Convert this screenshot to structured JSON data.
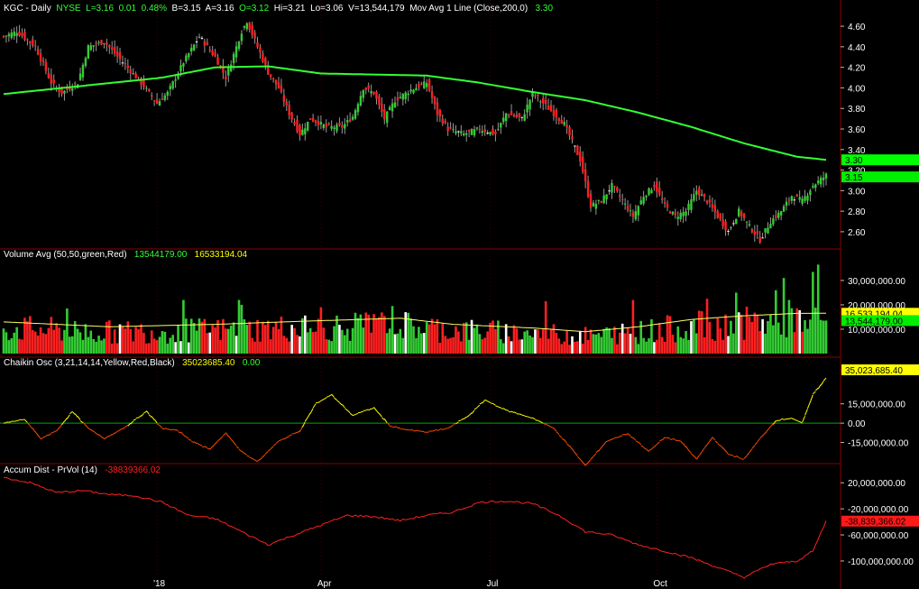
{
  "colors": {
    "background": "#000000",
    "up": "#33cc33",
    "down": "#ff2020",
    "flat": "#ffffff",
    "ma": "#33ff33",
    "chaikin": "#ffff00",
    "accum": "#ff2020",
    "axis_sep": "#8b0000"
  },
  "header": {
    "symbol": "KGC - Daily",
    "exchange": "NYSE",
    "last": "L=3.16",
    "change": "0.01",
    "change_pct": "0.48%",
    "bid": "B=3.15",
    "ask": "A=3.16",
    "open": "O=3.12",
    "high": "Hi=3.21",
    "low": "Lo=3.06",
    "volume": "V=13,544,179",
    "ma_label": "Mov Avg 1 Line (Close,200,0)",
    "ma_value": "3.30"
  },
  "volume_header": {
    "label": "Volume Avg (50,50,green,Red)",
    "v1": "13544179.00",
    "v2": "16533194.04"
  },
  "chaikin_header": {
    "label": "Chaikin Osc (3,21,14,14,Yellow,Red,Black)",
    "v1": "35023685.40",
    "v2": "0.00"
  },
  "accum_header": {
    "label": "Accum Dist - PrVol (14)",
    "v1": "-38839366.02"
  },
  "x_labels": [
    "'18",
    "Apr",
    "Jul",
    "Oct"
  ],
  "price_ticks": [
    "4.60",
    "4.40",
    "4.20",
    "4.00",
    "3.80",
    "3.60",
    "3.40",
    "3.20",
    "3.00",
    "2.80",
    "2.60"
  ],
  "price_tags": [
    "3.30",
    "3.15"
  ],
  "volume_ticks": [
    "30,000,000.00",
    "20,000,000.00",
    "10,000,000.00"
  ],
  "volume_tags": [
    "16,533,194.04",
    "13,544,179.00"
  ],
  "chaikin_ticks": [
    "15,000,000.00",
    "0.00",
    "-15,000,000.00"
  ],
  "chaikin_tag": "35,023,685.40",
  "accum_ticks": [
    "20,000,000.00",
    "-20,000,000.00",
    "-60,000,000.00",
    "-100,000,000.00"
  ],
  "accum_tag": "-38,839,366.02",
  "chart_data": [
    {
      "type": "candlestick",
      "title": "KGC - Daily",
      "ylim": [
        2.45,
        4.75
      ],
      "close_path": [
        [
          0,
          4.5
        ],
        [
          5,
          4.55
        ],
        [
          12,
          4.4
        ],
        [
          18,
          4.05
        ],
        [
          22,
          3.95
        ],
        [
          28,
          4.05
        ],
        [
          32,
          4.4
        ],
        [
          38,
          4.45
        ],
        [
          45,
          4.25
        ],
        [
          52,
          4.05
        ],
        [
          58,
          3.85
        ],
        [
          62,
          3.95
        ],
        [
          68,
          4.25
        ],
        [
          74,
          4.5
        ],
        [
          80,
          4.3
        ],
        [
          84,
          4.1
        ],
        [
          90,
          4.55
        ],
        [
          92,
          4.65
        ],
        [
          96,
          4.4
        ],
        [
          100,
          4.15
        ],
        [
          104,
          4.0
        ],
        [
          108,
          3.75
        ],
        [
          112,
          3.55
        ],
        [
          116,
          3.7
        ],
        [
          122,
          3.62
        ],
        [
          128,
          3.62
        ],
        [
          132,
          3.72
        ],
        [
          136,
          4.0
        ],
        [
          140,
          3.95
        ],
        [
          144,
          3.7
        ],
        [
          148,
          3.88
        ],
        [
          154,
          3.98
        ],
        [
          160,
          4.05
        ],
        [
          164,
          3.75
        ],
        [
          168,
          3.6
        ],
        [
          174,
          3.55
        ],
        [
          180,
          3.6
        ],
        [
          186,
          3.55
        ],
        [
          190,
          3.75
        ],
        [
          196,
          3.7
        ],
        [
          200,
          3.95
        ],
        [
          206,
          3.8
        ],
        [
          212,
          3.65
        ],
        [
          218,
          3.3
        ],
        [
          222,
          2.85
        ],
        [
          226,
          2.9
        ],
        [
          230,
          3.05
        ],
        [
          234,
          2.9
        ],
        [
          238,
          2.75
        ],
        [
          242,
          2.95
        ],
        [
          246,
          3.05
        ],
        [
          250,
          2.85
        ],
        [
          254,
          2.75
        ],
        [
          258,
          2.8
        ],
        [
          262,
          3.0
        ],
        [
          266,
          2.9
        ],
        [
          270,
          2.75
        ],
        [
          274,
          2.6
        ],
        [
          278,
          2.8
        ],
        [
          282,
          2.65
        ],
        [
          286,
          2.52
        ],
        [
          290,
          2.7
        ],
        [
          294,
          2.8
        ],
        [
          298,
          2.95
        ],
        [
          302,
          2.9
        ],
        [
          306,
          3.05
        ],
        [
          311,
          3.15
        ]
      ],
      "ma_path": [
        [
          0,
          3.94
        ],
        [
          30,
          4.02
        ],
        [
          60,
          4.1
        ],
        [
          80,
          4.2
        ],
        [
          100,
          4.21
        ],
        [
          120,
          4.14
        ],
        [
          140,
          4.13
        ],
        [
          160,
          4.12
        ],
        [
          180,
          4.05
        ],
        [
          200,
          3.96
        ],
        [
          220,
          3.88
        ],
        [
          240,
          3.76
        ],
        [
          260,
          3.62
        ],
        [
          280,
          3.46
        ],
        [
          300,
          3.33
        ],
        [
          311,
          3.3
        ]
      ],
      "last_close": 3.16,
      "last_ma": 3.3,
      "x_ticks": [
        {
          "day": 58,
          "label": "'18"
        },
        {
          "day": 120,
          "label": "Apr"
        },
        {
          "day": 184,
          "label": "Jul"
        },
        {
          "day": 247,
          "label": "Oct"
        }
      ]
    },
    {
      "type": "bar",
      "title": "Volume Avg (50,50,green,Red)",
      "ylim": [
        0,
        37000000
      ],
      "avg_path": [
        [
          0,
          13000000
        ],
        [
          40,
          11000000
        ],
        [
          80,
          12000000
        ],
        [
          120,
          13500000
        ],
        [
          150,
          14500000
        ],
        [
          170,
          12000000
        ],
        [
          200,
          10500000
        ],
        [
          220,
          9000000
        ],
        [
          240,
          11000000
        ],
        [
          260,
          14000000
        ],
        [
          280,
          15500000
        ],
        [
          300,
          16500000
        ],
        [
          311,
          16533194
        ]
      ],
      "spikes": [
        [
          24,
          18500000
        ],
        [
          68,
          22000000
        ],
        [
          89,
          22000000
        ],
        [
          90,
          20000000
        ],
        [
          120,
          19000000
        ],
        [
          147,
          19500000
        ],
        [
          205,
          21500000
        ],
        [
          238,
          22000000
        ],
        [
          266,
          22500000
        ],
        [
          277,
          25000000
        ],
        [
          292,
          26000000
        ],
        [
          295,
          31000000
        ],
        [
          297,
          22000000
        ],
        [
          306,
          33500000
        ],
        [
          308,
          36500000
        ]
      ],
      "last_volume": 13544179
    },
    {
      "type": "line",
      "title": "Chaikin Osc (3,21,14,14,Yellow,Red,Black)",
      "ylim": [
        -30000000,
        40000000
      ],
      "path": [
        [
          0,
          0
        ],
        [
          8,
          3000000
        ],
        [
          14,
          -12000000
        ],
        [
          20,
          -6000000
        ],
        [
          26,
          9000000
        ],
        [
          32,
          -4000000
        ],
        [
          38,
          -12000000
        ],
        [
          46,
          -3000000
        ],
        [
          54,
          9000000
        ],
        [
          60,
          -4000000
        ],
        [
          66,
          -6000000
        ],
        [
          72,
          -15000000
        ],
        [
          78,
          -20000000
        ],
        [
          84,
          -8000000
        ],
        [
          90,
          -22000000
        ],
        [
          96,
          -30000000
        ],
        [
          104,
          -14000000
        ],
        [
          112,
          -6000000
        ],
        [
          118,
          15000000
        ],
        [
          124,
          22000000
        ],
        [
          132,
          6000000
        ],
        [
          140,
          12000000
        ],
        [
          146,
          -2000000
        ],
        [
          152,
          -5000000
        ],
        [
          160,
          -7000000
        ],
        [
          168,
          -4000000
        ],
        [
          176,
          6000000
        ],
        [
          182,
          18000000
        ],
        [
          190,
          10000000
        ],
        [
          200,
          4000000
        ],
        [
          208,
          -4000000
        ],
        [
          214,
          -18000000
        ],
        [
          220,
          -33000000
        ],
        [
          228,
          -14000000
        ],
        [
          236,
          -8000000
        ],
        [
          244,
          -22000000
        ],
        [
          250,
          -11000000
        ],
        [
          256,
          -14000000
        ],
        [
          262,
          -28000000
        ],
        [
          268,
          -11000000
        ],
        [
          274,
          -24000000
        ],
        [
          280,
          -28000000
        ],
        [
          286,
          -12000000
        ],
        [
          292,
          2000000
        ],
        [
          298,
          4000000
        ],
        [
          302,
          0
        ],
        [
          306,
          22000000
        ],
        [
          311,
          35023685
        ]
      ]
    },
    {
      "type": "line",
      "title": "Accum Dist - PrVol (14)",
      "ylim": [
        -125000000,
        30000000
      ],
      "path": [
        [
          0,
          28000000
        ],
        [
          10,
          20000000
        ],
        [
          20,
          5000000
        ],
        [
          30,
          8000000
        ],
        [
          40,
          2000000
        ],
        [
          50,
          0
        ],
        [
          60,
          -10000000
        ],
        [
          70,
          -30000000
        ],
        [
          80,
          -35000000
        ],
        [
          90,
          -55000000
        ],
        [
          100,
          -75000000
        ],
        [
          110,
          -60000000
        ],
        [
          120,
          -45000000
        ],
        [
          130,
          -30000000
        ],
        [
          140,
          -32000000
        ],
        [
          150,
          -38000000
        ],
        [
          160,
          -30000000
        ],
        [
          170,
          -25000000
        ],
        [
          180,
          -10000000
        ],
        [
          190,
          -8000000
        ],
        [
          200,
          -12000000
        ],
        [
          210,
          -30000000
        ],
        [
          220,
          -55000000
        ],
        [
          230,
          -60000000
        ],
        [
          240,
          -75000000
        ],
        [
          250,
          -85000000
        ],
        [
          260,
          -95000000
        ],
        [
          270,
          -110000000
        ],
        [
          280,
          -125000000
        ],
        [
          290,
          -105000000
        ],
        [
          300,
          -100000000
        ],
        [
          306,
          -85000000
        ],
        [
          311,
          -38839366
        ]
      ]
    }
  ]
}
